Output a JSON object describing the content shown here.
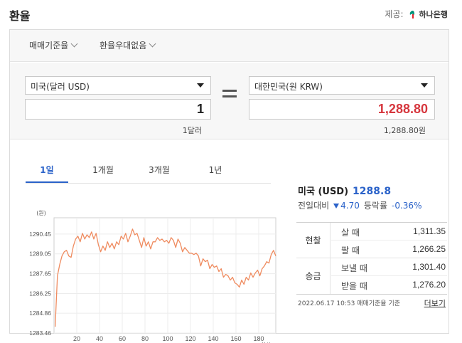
{
  "header": {
    "title": "환율",
    "provider_label": "제공:",
    "provider_name": "하나은행"
  },
  "settings": {
    "basis_label": "매매기준율",
    "discount_label": "환율우대없음"
  },
  "converter": {
    "from_currency": "미국(달러 USD)",
    "from_amount": "1",
    "from_sub": "1달러",
    "to_currency": "대한민국(원 KRW)",
    "to_amount": "1,288.80",
    "to_sub": "1,288.80원"
  },
  "tabs": [
    {
      "label": "1일",
      "active": true
    },
    {
      "label": "1개월",
      "active": false
    },
    {
      "label": "3개월",
      "active": false
    },
    {
      "label": "1년",
      "active": false
    }
  ],
  "rate": {
    "name": "미국 (USD)",
    "value": "1288.8",
    "diff_label": "전일대비",
    "diff_value": "4.70",
    "pct_label": "등락률",
    "pct_value": "-0.36%"
  },
  "rates_table": [
    {
      "group": "현찰",
      "rows": [
        {
          "label": "살 때",
          "value": "1,311.35"
        },
        {
          "label": "팔 때",
          "value": "1,266.25"
        }
      ]
    },
    {
      "group": "송금",
      "rows": [
        {
          "label": "보낼 때",
          "value": "1,301.40"
        },
        {
          "label": "받을 때",
          "value": "1,276.20"
        }
      ]
    }
  ],
  "footer": {
    "timestamp": "2022.06.17 10:53 매매기준율 기준",
    "more": "더보기"
  },
  "colors": {
    "accent": "#2a62c9",
    "negative": "#d6363d",
    "line": "#ef8b5f"
  },
  "chart_data": {
    "type": "line",
    "ylabel": "(원)",
    "xlabel": "(회차)",
    "ylim": [
      1283.46,
      1291.6
    ],
    "xlim": [
      0,
      195
    ],
    "yticks": [
      "1290.45",
      "1289.05",
      "1287.65",
      "1286.25",
      "1284.86",
      "1283.46"
    ],
    "ytick_values": [
      1290.45,
      1289.05,
      1287.65,
      1286.25,
      1284.86,
      1283.46
    ],
    "xticks": [
      20,
      40,
      60,
      80,
      100,
      120,
      140,
      160,
      180
    ],
    "series": [
      {
        "x": [
          1,
          3,
          5,
          7,
          9,
          11,
          13,
          15,
          17,
          19,
          21,
          23,
          25,
          27,
          29,
          31,
          33,
          35,
          37,
          39,
          41,
          43,
          45,
          47,
          49,
          51,
          53,
          55,
          57,
          59,
          61,
          63,
          65,
          67,
          69,
          71,
          73,
          75,
          77,
          79,
          81,
          83,
          85,
          87,
          89,
          91,
          93,
          95,
          97,
          99,
          101,
          103,
          105,
          107,
          109,
          111,
          113,
          115,
          117,
          119,
          121,
          123,
          125,
          127,
          129,
          131,
          133,
          135,
          137,
          139,
          141,
          143,
          145,
          147,
          149,
          151,
          153,
          155,
          157,
          159,
          161,
          163,
          165,
          167,
          169,
          171,
          173,
          175,
          177,
          179,
          181,
          183,
          185,
          187,
          189,
          191,
          193,
          195
        ],
        "y": [
          1283.9,
          1287.5,
          1288.3,
          1288.9,
          1289.2,
          1289.3,
          1288.9,
          1288.8,
          1289.6,
          1290.1,
          1290.3,
          1289.9,
          1290.5,
          1290.1,
          1290.4,
          1290.2,
          1290.6,
          1290.1,
          1290.5,
          1289.7,
          1289.2,
          1289.6,
          1289.3,
          1289.9,
          1289.5,
          1289.8,
          1289.4,
          1289.9,
          1289.7,
          1290.3,
          1290.1,
          1290.5,
          1289.9,
          1290.3,
          1290.8,
          1290.4,
          1290.5,
          1290.0,
          1289.5,
          1290.2,
          1289.6,
          1289.9,
          1289.4,
          1289.9,
          1289.9,
          1290.2,
          1290.0,
          1290.1,
          1289.9,
          1290.0,
          1289.8,
          1290.2,
          1290.0,
          1289.5,
          1290.1,
          1289.8,
          1289.2,
          1289.5,
          1289.3,
          1289.1,
          1289.1,
          1289.0,
          1289.1,
          1288.9,
          1288.2,
          1288.7,
          1288.5,
          1288.6,
          1288.0,
          1288.3,
          1288.1,
          1288.2,
          1287.8,
          1288.0,
          1287.4,
          1287.6,
          1287.5,
          1287.2,
          1287.4,
          1287.0,
          1286.9,
          1286.7,
          1287.2,
          1286.9,
          1287.4,
          1287.2,
          1287.7,
          1287.4,
          1287.7,
          1287.9,
          1287.5,
          1288.0,
          1288.2,
          1288.5,
          1288.4,
          1289.0,
          1289.3,
          1288.9
        ]
      }
    ],
    "grid": true
  }
}
